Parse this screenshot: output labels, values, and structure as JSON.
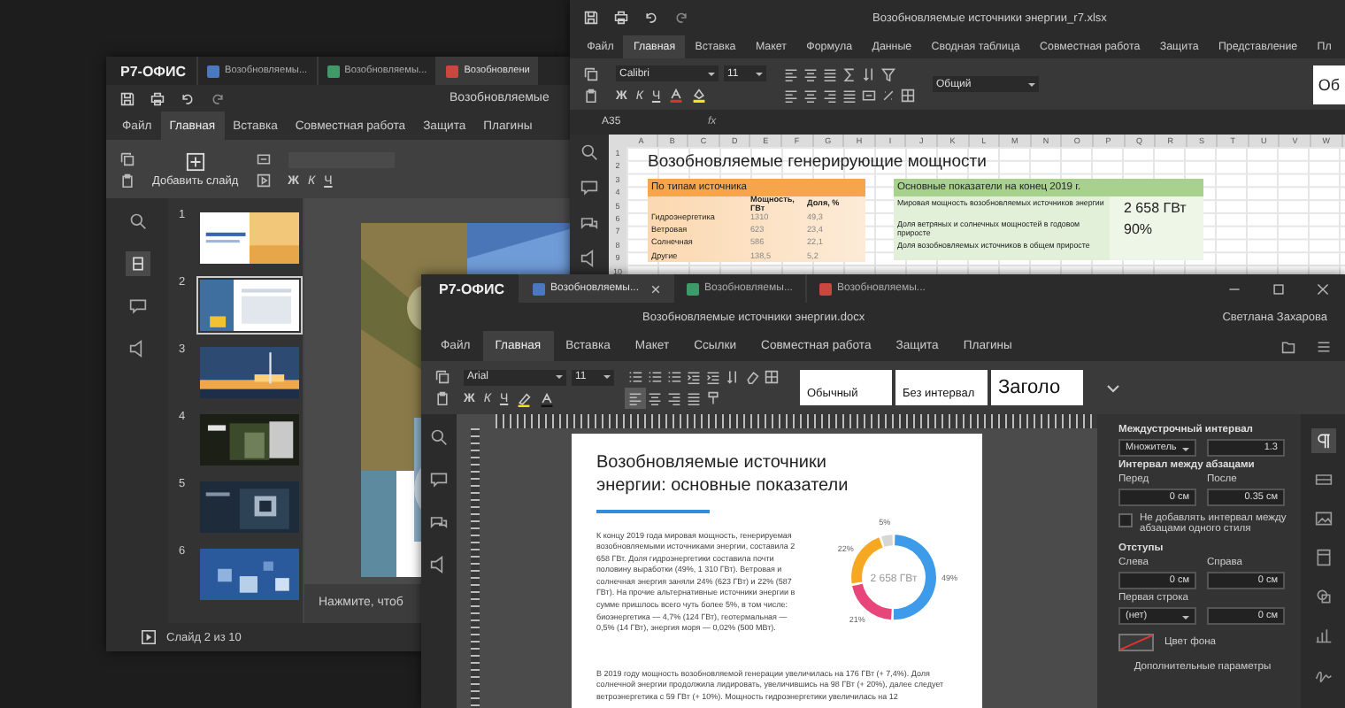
{
  "presentation_window": {
    "brand": "Р7-ОФИС",
    "tabs": [
      {
        "label": "Возобновляемы...",
        "color": "#4a78c2",
        "selected": false
      },
      {
        "label": "Возобновляемы...",
        "color": "#3f9a6a",
        "selected": false
      },
      {
        "label": "Возобновлени",
        "color": "#c9473f",
        "selected": true
      }
    ],
    "title": "Возобновляемые",
    "menu": [
      {
        "label": "Файл",
        "selected": false
      },
      {
        "label": "Главная",
        "selected": true
      },
      {
        "label": "Вставка",
        "selected": false
      },
      {
        "label": "Совместная работа",
        "selected": false
      },
      {
        "label": "Защита",
        "selected": false
      },
      {
        "label": "Плагины",
        "selected": false
      }
    ],
    "add_slide": "Добавить слайд",
    "format_letters": [
      "Ж",
      "К",
      "Ч"
    ],
    "slides": [
      {
        "number": "1",
        "selected": false
      },
      {
        "number": "2",
        "selected": true
      },
      {
        "number": "3",
        "selected": false
      },
      {
        "number": "4",
        "selected": false
      },
      {
        "number": "5",
        "selected": false
      },
      {
        "number": "6",
        "selected": false
      }
    ],
    "notes_placeholder": "Нажмите, чтоб",
    "status": "Слайд 2 из 10"
  },
  "spreadsheet_window": {
    "title": "Возобновляемые источники энергии_r7.xlsx",
    "menu": [
      {
        "label": "Файл",
        "selected": false
      },
      {
        "label": "Главная",
        "selected": true
      },
      {
        "label": "Вставка",
        "selected": false
      },
      {
        "label": "Макет",
        "selected": false
      },
      {
        "label": "Формула",
        "selected": false
      },
      {
        "label": "Данные",
        "selected": false
      },
      {
        "label": "Сводная таблица",
        "selected": false
      },
      {
        "label": "Совместная работа",
        "selected": false
      },
      {
        "label": "Защита",
        "selected": false
      },
      {
        "label": "Представление",
        "selected": false
      },
      {
        "label": "Пл",
        "selected": false
      }
    ],
    "font": "Calibri",
    "font_size": "11",
    "format_letters": [
      "Ж",
      "К",
      "Ч"
    ],
    "number_format": "Общий",
    "style_preview": "Об",
    "cell_ref": "A35",
    "fx": "fx",
    "column_headers": [
      "A",
      "B",
      "C",
      "D",
      "E",
      "F",
      "G",
      "H",
      "I",
      "J",
      "K",
      "L",
      "M",
      "N",
      "O",
      "P",
      "Q",
      "R",
      "S",
      "T",
      "U",
      "V",
      "W"
    ],
    "row_numbers": [
      "1",
      "2",
      "3",
      "4",
      "5",
      "6",
      "7",
      "8",
      "9",
      "10"
    ],
    "sheet_title": "Возобновляемые генерирующие мощности",
    "left_table": {
      "header": "По типам источника",
      "columns": [
        "Мощность, ГВт",
        "Доля, %"
      ],
      "rows": [
        {
          "label": "Гидроэнергетика",
          "power": "1310",
          "share": "49,3"
        },
        {
          "label": "Ветровая",
          "power": "623",
          "share": "23,4"
        },
        {
          "label": "Солнечная",
          "power": "586",
          "share": "22,1"
        },
        {
          "label": "Другие",
          "power": "138,5",
          "share": "5,2"
        }
      ]
    },
    "right_table": {
      "header": "Основные показатели на конец 2019 г.",
      "rows": [
        {
          "label": "Мировая мощность возобновляемых источников энергии",
          "value": "2 658 ГВт"
        },
        {
          "label": "Доля ветряных и солнечных мощностей в годовом приросте",
          "value": "90%"
        },
        {
          "label": "Доля возобновляемых источников в общем приросте"
        }
      ]
    }
  },
  "document_window": {
    "brand": "Р7-ОФИС",
    "tabs": [
      {
        "label": "Возобновляемы...",
        "color": "#4a78c2",
        "selected": true,
        "closable": true
      },
      {
        "label": "Возобновляемы...",
        "color": "#3f9a6a",
        "selected": false,
        "closable": false
      },
      {
        "label": "Возобновляемы...",
        "color": "#c9473f",
        "selected": false,
        "closable": false
      }
    ],
    "title": "Возобновляемые источники энергии.docx",
    "user": "Светлана Захарова",
    "menu": [
      {
        "label": "Файл",
        "selected": false
      },
      {
        "label": "Главная",
        "selected": true
      },
      {
        "label": "Вставка",
        "selected": false
      },
      {
        "label": "Макет",
        "selected": false
      },
      {
        "label": "Ссылки",
        "selected": false
      },
      {
        "label": "Совместная работа",
        "selected": false
      },
      {
        "label": "Защита",
        "selected": false
      },
      {
        "label": "Плагины",
        "selected": false
      }
    ],
    "font": "Arial",
    "font_size": "11",
    "format_letters": [
      "Ж",
      "К",
      "Ч"
    ],
    "styles": [
      {
        "label": "Обычный",
        "kind": "normal"
      },
      {
        "label": "Без интервал",
        "kind": "normal"
      },
      {
        "label": "Заголо",
        "kind": "heading"
      }
    ],
    "page": {
      "heading": "Возобновляемые источники энергии: основные показатели",
      "paragraph_1": "К концу 2019 года мировая мощность, генерируемая возобновляемыми источниками энергии, составила 2 658 ГВт. Доля гидроэнергетики составила почти половину выработки (49%, 1 310 ГВт). Ветровая и солнечная энергия заняли 24% (623 ГВт) и 22% (587 ГВт). На прочие альтернативные источники энергии в сумме пришлось всего чуть более 5%, в том числе: биоэнергетика — 4,7% (124 ГВт), геотермальная — 0,5% (14 ГВт), энергия моря — 0,02% (500 МВт).",
      "donut_center": "2 658 ГВт",
      "chart_data": {
        "type": "donut",
        "values": [
          49,
          21,
          22,
          5
        ],
        "value_labels": [
          "49%",
          "21%",
          "22%",
          "5%"
        ],
        "colors": [
          "#3d9be9",
          "#e8457a",
          "#f7a823",
          "#d6d6d6"
        ]
      },
      "paragraph_2": "В 2019 году мощность возобновляемой генерации увеличилась на 176 ГВт (+ 7,4%). Доля солнечной энергии продолжила лидировать, увеличившись на 98 ГВт (+ 20%), далее следует ветроэнергетика с 59 ГВт (+ 10%). Мощность гидроэнергетики увеличилась на 12"
    },
    "panel": {
      "line_spacing_label": "Междустрочный интервал",
      "line_spacing_mode": "Множитель",
      "line_spacing_value": "1.3",
      "paragraph_spacing_label": "Интервал между абзацами",
      "before_label": "Перед",
      "before_value": "0 см",
      "after_label": "После",
      "after_value": "0.35 см",
      "no_spacing_same_style": {
        "label": "Не добавлять интервал между абзацами одного стиля",
        "checked": false
      },
      "indents_label": "Отступы",
      "left_label": "Слева",
      "left_value": "0 см",
      "right_label": "Справа",
      "right_value": "0 см",
      "first_line_label": "Первая строка",
      "first_line_mode": "(нет)",
      "first_line_value": "0 см",
      "background_color_label": "Цвет фона",
      "advanced_link": "Дополнительные параметры"
    }
  }
}
